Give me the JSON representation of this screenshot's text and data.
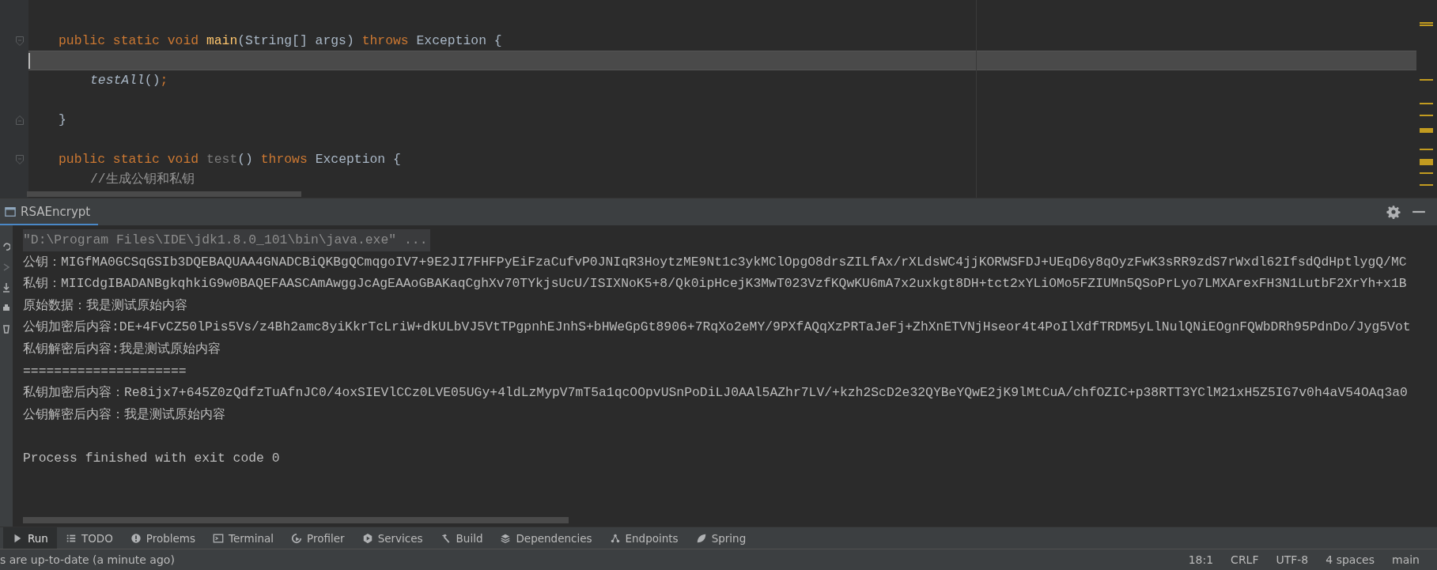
{
  "editor": {
    "lines": [
      {
        "current": false
      },
      {
        "current": false,
        "kind": "head",
        "tokens": [
          {
            "text": "public static void ",
            "kind": "keyword"
          },
          {
            "text": "main",
            "kind": "declaration"
          },
          {
            "text": "(String[] args) ",
            "kind": "text"
          },
          {
            "text": "throws ",
            "kind": "keyword"
          },
          {
            "text": "Exception {",
            "kind": "text"
          }
        ]
      },
      {
        "current": true
      },
      {
        "current": false,
        "kind": "body",
        "tokens": [
          {
            "text": "testAll",
            "kind": "call"
          },
          {
            "text": "()",
            "kind": "text"
          },
          {
            "text": ";",
            "kind": "punct"
          }
        ]
      },
      {
        "current": false
      },
      {
        "current": false,
        "kind": "close",
        "tokens": [
          {
            "text": "}",
            "kind": "text"
          }
        ]
      },
      {
        "current": false
      },
      {
        "current": false,
        "kind": "head",
        "tokens": [
          {
            "text": "public static void ",
            "kind": "keyword"
          },
          {
            "text": "test",
            "kind": "unused"
          },
          {
            "text": "() ",
            "kind": "text"
          },
          {
            "text": "throws ",
            "kind": "keyword"
          },
          {
            "text": "Exception {",
            "kind": "text"
          }
        ]
      },
      {
        "current": false,
        "kind": "body",
        "tokens": [
          {
            "text": "//生成公钥和私钥",
            "kind": "comment"
          }
        ]
      }
    ]
  },
  "run_window": {
    "tab": {
      "label": "RSAEncrypt",
      "selected": true
    },
    "console": [
      {
        "kind": "command",
        "text": "\"D:\\Program Files\\IDE\\jdk1.8.0_101\\bin\\java.exe\" ..."
      },
      {
        "kind": "output",
        "text": "公钥：MIGfMA0GCSqGSIb3DQEBAQUAA4GNADCBiQKBgQCmqgoIV7+9E2JI7FHFPyEiFzaCufvP0JNIqR3HoytzME9Nt1c3ykMClOpgO8drsZILfAx/rXLdsWC4jjKORWSFDJ+UEqD6y8qOyzFwK3sRR9zdS7rWxdl62IfsdQdHptlygQ/MC"
      },
      {
        "kind": "output",
        "text": "私钥：MIICdgIBADANBgkqhkiG9w0BAQEFAASCAmAwggJcAgEAAoGBAKaqCghXv70TYkjsUcU/ISIXNoK5+8/Qk0ipHcejK3MwT023VzfKQwKU6mA7x2uxkgt8DH+tct2xYLiOMo5FZIUMn5QSoPrLyo7LMXArexFH3N1LutbF2XrYh+x1B"
      },
      {
        "kind": "output",
        "text": "原始数据：我是测试原始内容"
      },
      {
        "kind": "output",
        "text": "公钥加密后内容:DE+4FvCZ50lPis5Vs/z4Bh2amc8yiKkrTcLriW+dkULbVJ5VtTPgpnhEJnhS+bHWeGpGt8906+7RqXo2eMY/9PXfAQqXzPRTaJeFj+ZhXnETVNjHseor4t4PoIlXdfTRDM5yLlNulQNiEOgnFQWbDRh95PdnDo/Jyg5Vot"
      },
      {
        "kind": "output",
        "text": "私钥解密后内容:我是测试原始内容"
      },
      {
        "kind": "output",
        "text": "====================="
      },
      {
        "kind": "output",
        "text": "私钥加密后内容：Re8ijx7+645Z0zQdfzTuAfnJC0/4oxSIEVlCCz0LVE05UGy+4ldLzMypV7mT5a1qcOOpvUSnPoDiLJ0AAl5AZhr7LV/+kzh2ScD2e32QYBeYQwE2jK9lMtCuA/chfOZIC+p38RTT3YClM21xH5Z5IG7v0h4aV54OAq3a0"
      },
      {
        "kind": "output",
        "text": "公钥解密后内容：我是测试原始内容"
      },
      {
        "kind": "blank"
      },
      {
        "kind": "output",
        "text": "Process finished with exit code 0"
      }
    ]
  },
  "tool_tabs": [
    {
      "label": "Run",
      "selected": true
    },
    {
      "label": "TODO",
      "selected": false
    },
    {
      "label": "Problems",
      "selected": false
    },
    {
      "label": "Terminal",
      "selected": false
    },
    {
      "label": "Profiler",
      "selected": false
    },
    {
      "label": "Services",
      "selected": false
    },
    {
      "label": "Build",
      "selected": false
    },
    {
      "label": "Dependencies",
      "selected": false
    },
    {
      "label": "Endpoints",
      "selected": false
    },
    {
      "label": "Spring",
      "selected": false
    }
  ],
  "status_bar": {
    "message": "s are up-to-date (a minute ago)",
    "items": [
      "18:1",
      "CRLF",
      "UTF-8",
      "4 spaces",
      "main"
    ]
  }
}
